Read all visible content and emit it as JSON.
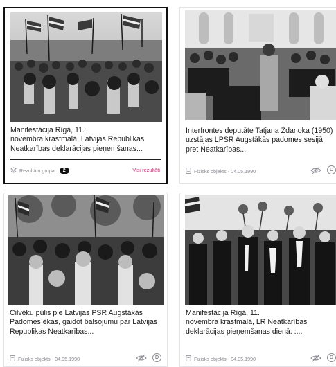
{
  "cards": [
    {
      "title": "Manifestācija Rīgā, 11.\nnovembra krastmalā, Latvijas Republikas Neatkarības deklarācijas pieņemšanas...",
      "group_label": "Rezultātu grupa",
      "group_count": "2",
      "all_results_label": "Visi rezultāti",
      "selected": true
    },
    {
      "title": "Interfrontes deputāte Tatjana Ždanoka (1950) uzstājas LPSR Augstākās padomes sesijā pret Neatkarības...",
      "meta": "Fizisks objekts - 04.05.1990",
      "d_label": "D"
    },
    {
      "title": "Cilvēku pūlis pie Latvijas PSR Augstākās Padomes ēkas, gaidot balsojumu par Latvijas Republikas Neatkarības...",
      "meta": "Fizisks objekts - 04.05.1990",
      "d_label": "D"
    },
    {
      "title": "Manifestācija Rīgā, 11.\nnovembra krastmalā, LR Neatkarības deklarācijas pieņemšanas dienā. :...",
      "meta": "Fizisks objekts - 04.05.1990",
      "d_label": "D"
    }
  ],
  "colors": {
    "link": "#c2447a",
    "badge_bg": "#111111",
    "meta": "#8b8b93"
  }
}
